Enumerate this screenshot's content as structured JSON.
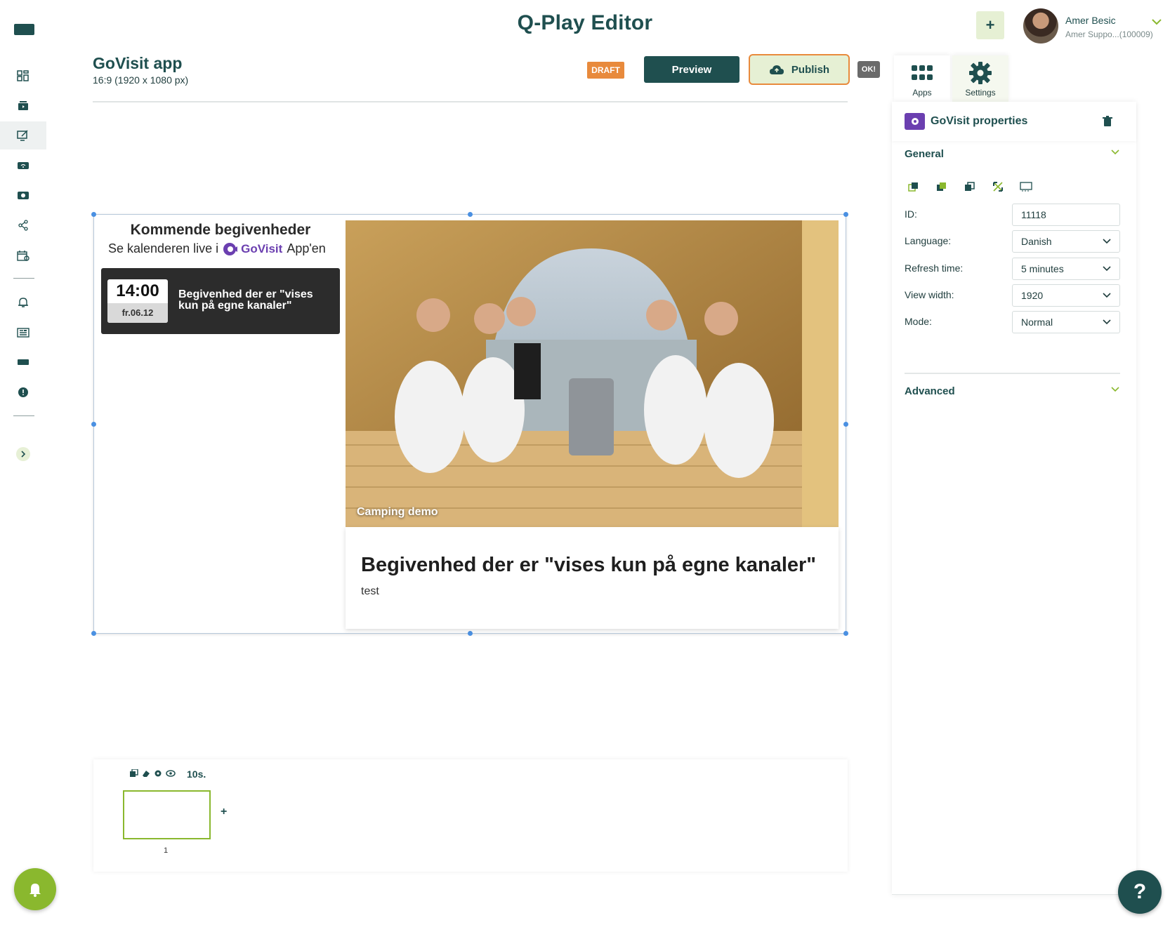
{
  "header": {
    "app_title": "Q-Play Editor",
    "plus_label": "+",
    "user": {
      "name": "Amer Besic",
      "sub": "Amer Suppo...(100009)"
    }
  },
  "page": {
    "title": "GoVisit app",
    "subtitle": "16:9 (1920 x 1080 px)",
    "draft_label": "DRAFT",
    "preview_label": "Preview",
    "publish_label": "Publish",
    "ok_label": "OK!"
  },
  "sidebar": {
    "items": [
      "layout-grid-icon",
      "media-icon",
      "editor-icon",
      "wifi-icon",
      "camera-icon",
      "share-icon",
      "calendar-icon",
      "alarm-icon",
      "news-icon",
      "screen-icon",
      "alert-icon"
    ],
    "active": "editor-icon"
  },
  "canvas": {
    "heading": "Kommende begivenheder",
    "sub_prefix": "Se kalenderen live i",
    "brand": "GoVisit",
    "sub_suffix": "App'en",
    "event": {
      "time": "14:00",
      "date": "fr.06.12",
      "title": "Begivenhed der er \"vises kun på egne kanaler\""
    },
    "photo_caption": "Camping demo",
    "detail_title": "Begivenhed der er \"vises kun på egne kanaler\"",
    "detail_desc": "test"
  },
  "timeline": {
    "duration": "10s.",
    "slide_number": "1",
    "add_label": "+"
  },
  "right_panel": {
    "tabs": [
      {
        "label": "Apps",
        "icon": "grid-icon"
      },
      {
        "label": "Settings",
        "icon": "gear-icon"
      }
    ],
    "active_tab": "Settings",
    "title": "GoVisit properties",
    "general_label": "General",
    "advanced_label": "Advanced",
    "fields": {
      "id": {
        "label": "ID:",
        "value": "11118"
      },
      "language": {
        "label": "Language:",
        "value": "Danish"
      },
      "refresh": {
        "label": "Refresh time:",
        "value": "5 minutes"
      },
      "view_width": {
        "label": "View width:",
        "value": "1920"
      },
      "mode": {
        "label": "Mode:",
        "value": "Normal"
      }
    }
  },
  "help_label": "?",
  "colors": {
    "brand_dark": "#1f4f4f",
    "accent_green": "#8ab82e",
    "accent_orange": "#e88a3c",
    "govisit_purple": "#6b3fb0"
  }
}
